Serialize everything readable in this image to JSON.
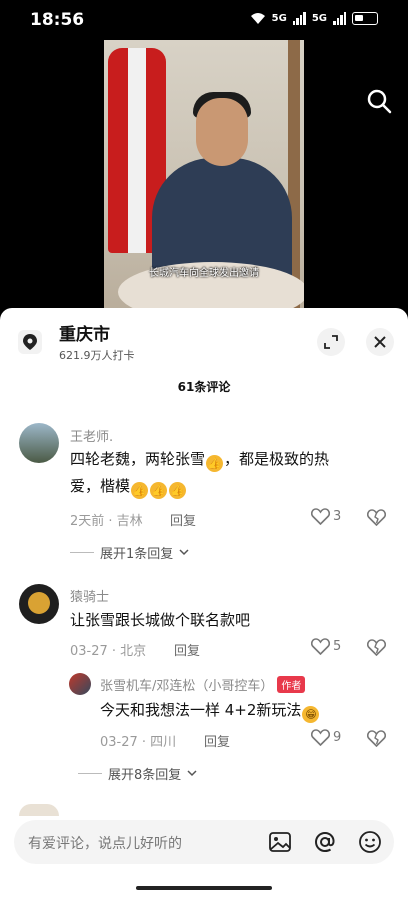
{
  "status_bar": {
    "time": "18:56",
    "signal_1": "5G",
    "signal_2": "5G"
  },
  "video": {
    "subtitle": "长城汽车向全球发出邀请"
  },
  "location": {
    "name": "重庆市",
    "checkins": "621.9万人打卡"
  },
  "comments_header": {
    "count_label": "61条评论"
  },
  "comments": [
    {
      "user": "王老师.",
      "text_line1": "四轮老魏，两轮张雪",
      "text_line1b": "，都是极致的热",
      "text_line2": "爱，楷模",
      "time": "2天前 · 吉林",
      "reply_label": "回复",
      "likes": "3",
      "expand_label": "展开1条回复"
    },
    {
      "user": "猿骑士",
      "text": "让张雪跟长城做个联名款吧",
      "time": "03-27 · 北京",
      "reply_label": "回复",
      "likes": "5",
      "sub_reply": {
        "user": "张雪机车/邓连松（小哥控车）",
        "author_tag": "作者",
        "text": "今天和我想法一样  4+2新玩法",
        "time": "03-27 · 四川",
        "reply_label": "回复",
        "likes": "9"
      },
      "expand_label": "展开8条回复"
    }
  ],
  "input": {
    "placeholder": "有爱评论，说点儿好听的"
  },
  "icons": {
    "search": "search-icon",
    "location": "location-pin-icon",
    "expand": "expand-icon",
    "close": "close-icon",
    "like": "heart-icon",
    "dislike": "broken-heart-icon",
    "image": "image-icon",
    "mention": "at-icon",
    "emoji": "emoji-icon"
  },
  "colors": {
    "author_tag": "#e8394b",
    "sheet_bg": "#ffffff",
    "video_bg": "#000000"
  }
}
